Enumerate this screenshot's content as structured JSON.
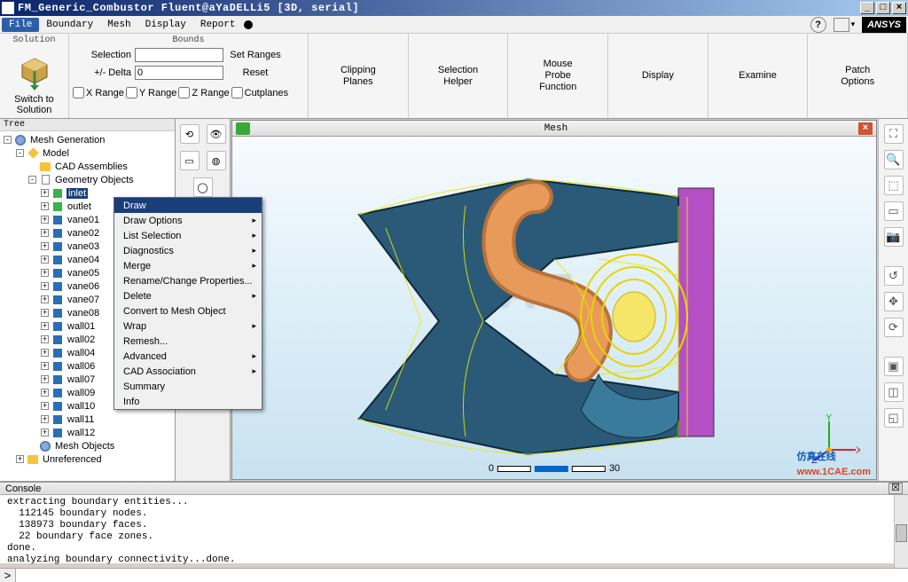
{
  "title": "FM_Generic_Combustor Fluent@aYaDELLi5  [3D, serial]",
  "menubar": {
    "file": "File",
    "boundary": "Boundary",
    "mesh": "Mesh",
    "display": "Display",
    "report": "Report",
    "ansys": "ANSYS"
  },
  "ribbon": {
    "solution": {
      "title": "Solution",
      "switch": "Switch to\nSolution"
    },
    "bounds": {
      "title": "Bounds",
      "selection": "Selection",
      "selection_val": "",
      "delta": "+/- Delta",
      "delta_val": "0",
      "setranges": "Set Ranges",
      "reset": "Reset",
      "xr": "X Range",
      "yr": "Y Range",
      "zr": "Z Range",
      "cut": "Cutplanes"
    },
    "btns": {
      "clip": "Clipping\nPlanes",
      "selh": "Selection\nHelper",
      "probe": "Mouse\nProbe\nFunction",
      "disp": "Display",
      "exam": "Examine",
      "patch": "Patch\nOptions"
    }
  },
  "tree": {
    "title": "Tree",
    "root": "Mesh Generation",
    "model": "Model",
    "cad": "CAD Assemblies",
    "geo": "Geometry Objects",
    "items": [
      "inlet",
      "outlet",
      "vane01",
      "vane02",
      "vane03",
      "vane04",
      "vane05",
      "vane06",
      "vane07",
      "vane08",
      "wall01",
      "wall02",
      "wall04",
      "wall06",
      "wall07",
      "wall09",
      "wall10",
      "wall11",
      "wall12"
    ],
    "meshobj": "Mesh Objects",
    "unref": "Unreferenced"
  },
  "ctx": {
    "items": [
      {
        "l": "Draw",
        "s": false,
        "hl": true
      },
      {
        "l": "Draw Options",
        "s": true
      },
      {
        "l": "List Selection",
        "s": true
      },
      {
        "l": "Diagnostics",
        "s": true
      },
      {
        "l": "Merge",
        "s": true
      },
      {
        "l": "Rename/Change Properties...",
        "s": false
      },
      {
        "l": "Delete",
        "s": true
      },
      {
        "l": "Convert to Mesh Object",
        "s": false
      },
      {
        "l": "Wrap",
        "s": true
      },
      {
        "l": "Remesh...",
        "s": false
      },
      {
        "l": "Advanced",
        "s": true
      },
      {
        "l": "CAD Association",
        "s": true
      },
      {
        "l": "Summary",
        "s": false
      },
      {
        "l": "Info",
        "s": false
      }
    ]
  },
  "view": {
    "tab": "Mesh",
    "scale": {
      "a": "0",
      "b": "30"
    }
  },
  "watermark": "1CAE",
  "brand": {
    "cn": "仿真在线",
    "url": "www.1CAE.com"
  },
  "console": {
    "title": "Console",
    "lines": "extracting boundary entities...\n  112145 boundary nodes.\n  138973 boundary faces.\n  22 boundary face zones.\ndone.\nanalyzing boundary connectivity...done.",
    "prompt": ">"
  }
}
